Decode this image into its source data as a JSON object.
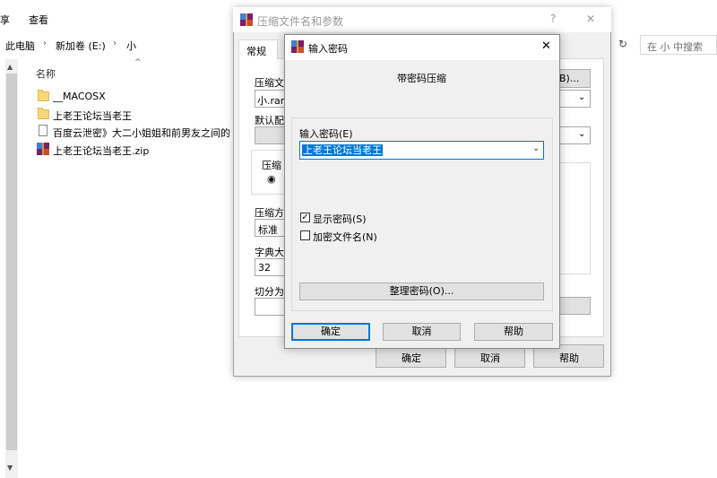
{
  "explorer": {
    "ribbon": [
      "享",
      "查看"
    ],
    "breadcrumb": [
      "此电脑",
      "新加卷 (E:)",
      "小"
    ],
    "search_placeholder": "在 小 中搜索",
    "column_name": "名称",
    "files": [
      {
        "name": "__MACOSX",
        "type": "folder"
      },
      {
        "name": "上老王论坛当老王",
        "type": "folder"
      },
      {
        "name": "百度云泄密》大二小姐姐和前男友之间的",
        "type": "document"
      },
      {
        "name": "上老王论坛当老王.zip",
        "type": "archive"
      }
    ]
  },
  "archive_dialog": {
    "title": "压缩文件名和参数",
    "help_glyph": "?",
    "close_glyph": "✕",
    "tab_general": "常规",
    "archive_name_label": "压缩文",
    "archive_name_value": "小.rar",
    "browse_label": "B)...",
    "default_profile_label": "默认配",
    "format_group_label": "压缩",
    "method_label": "压缩方",
    "method_value": "标准",
    "dict_label": "字典大",
    "dict_value": "32",
    "split_label": "切分为",
    "ok": "确定",
    "cancel": "取消",
    "help": "帮助"
  },
  "password_dialog": {
    "title": "输入密码",
    "close_glyph": "✕",
    "heading": "带密码压缩",
    "password_label": "输入密码(E)",
    "password_value": "上老王论坛当老王",
    "show_password_label": "显示密码(S)",
    "show_password_checked": true,
    "encrypt_names_label": "加密文件名(N)",
    "encrypt_names_checked": false,
    "organize_button": "整理密码(O)...",
    "ok": "确定",
    "cancel": "取消",
    "help": "帮助"
  }
}
